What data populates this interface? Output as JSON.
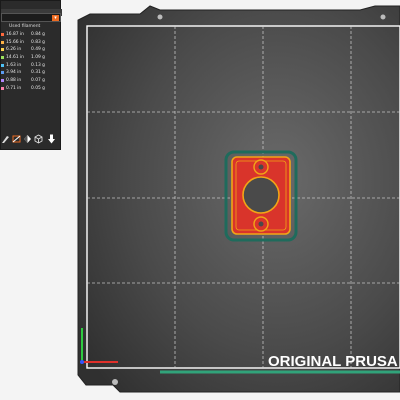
{
  "legend": {
    "header": "Used filament",
    "rows": [
      {
        "length": "16.87 in",
        "weight": "0.84 g",
        "color": "#ff6a3d"
      },
      {
        "length": "15.66 in",
        "weight": "0.83 g",
        "color": "#ffb347"
      },
      {
        "length": "6.26 in",
        "weight": "0.49 g",
        "color": "#ffd54f"
      },
      {
        "length": "14.61 in",
        "weight": "1.09 g",
        "color": "#9be15d"
      },
      {
        "length": "1.63 in",
        "weight": "0.13 g",
        "color": "#4fc3f7"
      },
      {
        "length": "3.94 in",
        "weight": "0.31 g",
        "color": "#5c9df2"
      },
      {
        "length": "0.88 in",
        "weight": "0.07 g",
        "color": "#b388ff"
      },
      {
        "length": "0.71 in",
        "weight": "0.05 g",
        "color": "#ff80ab"
      }
    ],
    "tools": [
      "paint-icon",
      "seam-icon",
      "support-icon",
      "cube-icon",
      "download-icon"
    ]
  },
  "bed": {
    "logo": "ORIGINAL PRUSA",
    "surface_color": "#3a3a3a",
    "grid_color": "#ffffff",
    "part_color": "#d9342b",
    "perimeter_color": "#f2a516",
    "skirt_color": "#1f6b5c"
  }
}
